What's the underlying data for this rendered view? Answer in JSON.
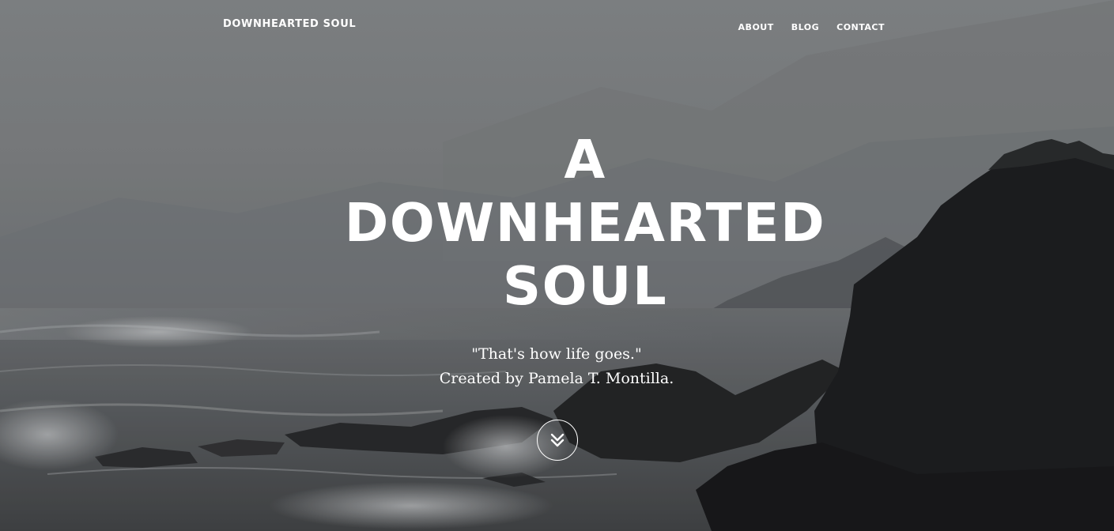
{
  "nav": {
    "brand": "DOWNHEARTED SOUL",
    "items": [
      {
        "label": "ABOUT"
      },
      {
        "label": "BLOG"
      },
      {
        "label": "CONTACT"
      }
    ]
  },
  "hero": {
    "title_lines": [
      "A",
      "DOWNHEARTED",
      "SOUL"
    ],
    "quote": "\"That's how life goes.\"",
    "credit": "Created by Pamela T. Montilla.",
    "scroll_icon": "double-chevron-down-icon",
    "background": "grayscale-coastal-rocks-photo"
  },
  "colors": {
    "text": "#ffffff",
    "sky": "#86898b",
    "rock": "#1c1d1f"
  }
}
